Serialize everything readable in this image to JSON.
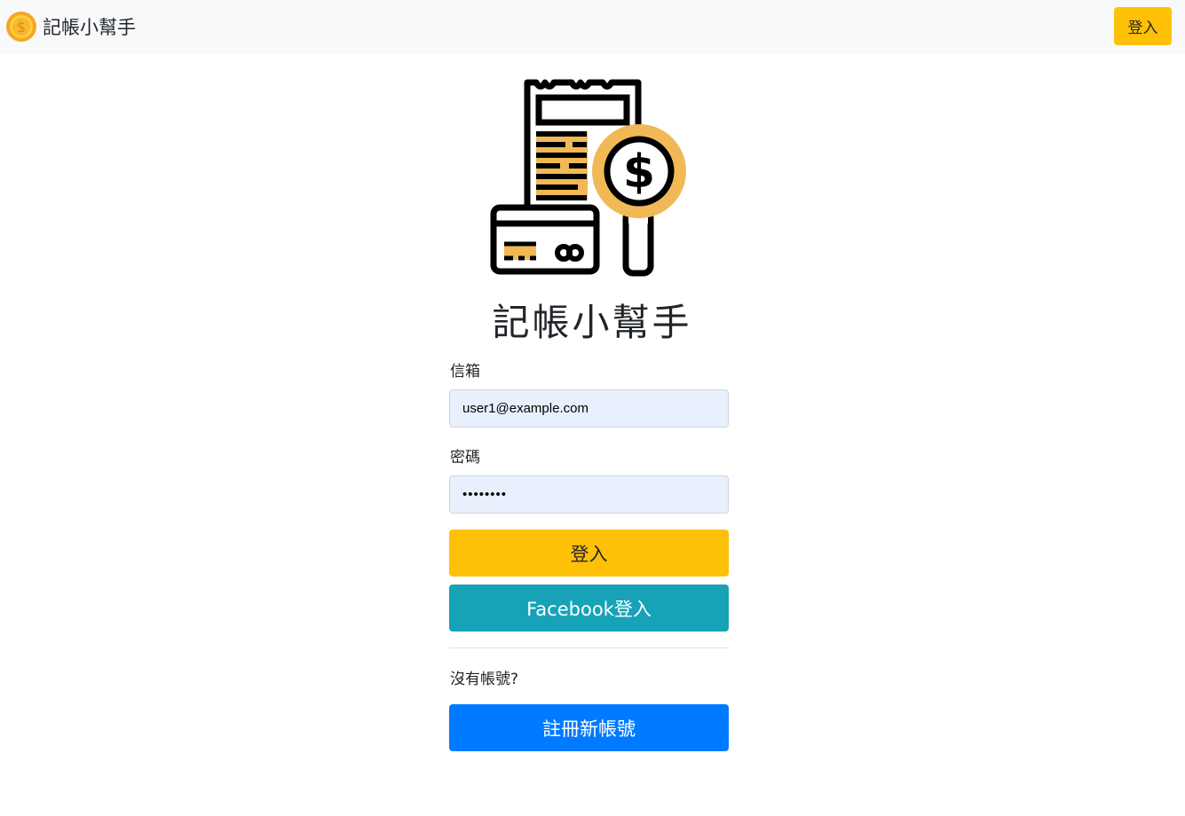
{
  "navbar": {
    "brand_name": "記帳小幫手",
    "logo_icon": "coin-dollar-icon",
    "login_label": "登入"
  },
  "hero": {
    "icon": "receipt-card-dollar-icon",
    "title": "記帳小幫手"
  },
  "form": {
    "email_label": "信箱",
    "email_value": "user1@example.com",
    "password_label": "密碼",
    "password_value": "••••••••",
    "login_button": "登入",
    "facebook_button": "Facebook登入"
  },
  "register": {
    "prompt": "沒有帳號?",
    "button": "註冊新帳號"
  },
  "colors": {
    "navbar_bg": "#f8f9fa",
    "primary_yellow": "#ffc107",
    "facebook_teal": "#17a2b8",
    "register_blue": "#007bff",
    "input_bg": "#e8f0fe",
    "icon_orange": "#f0b956"
  }
}
